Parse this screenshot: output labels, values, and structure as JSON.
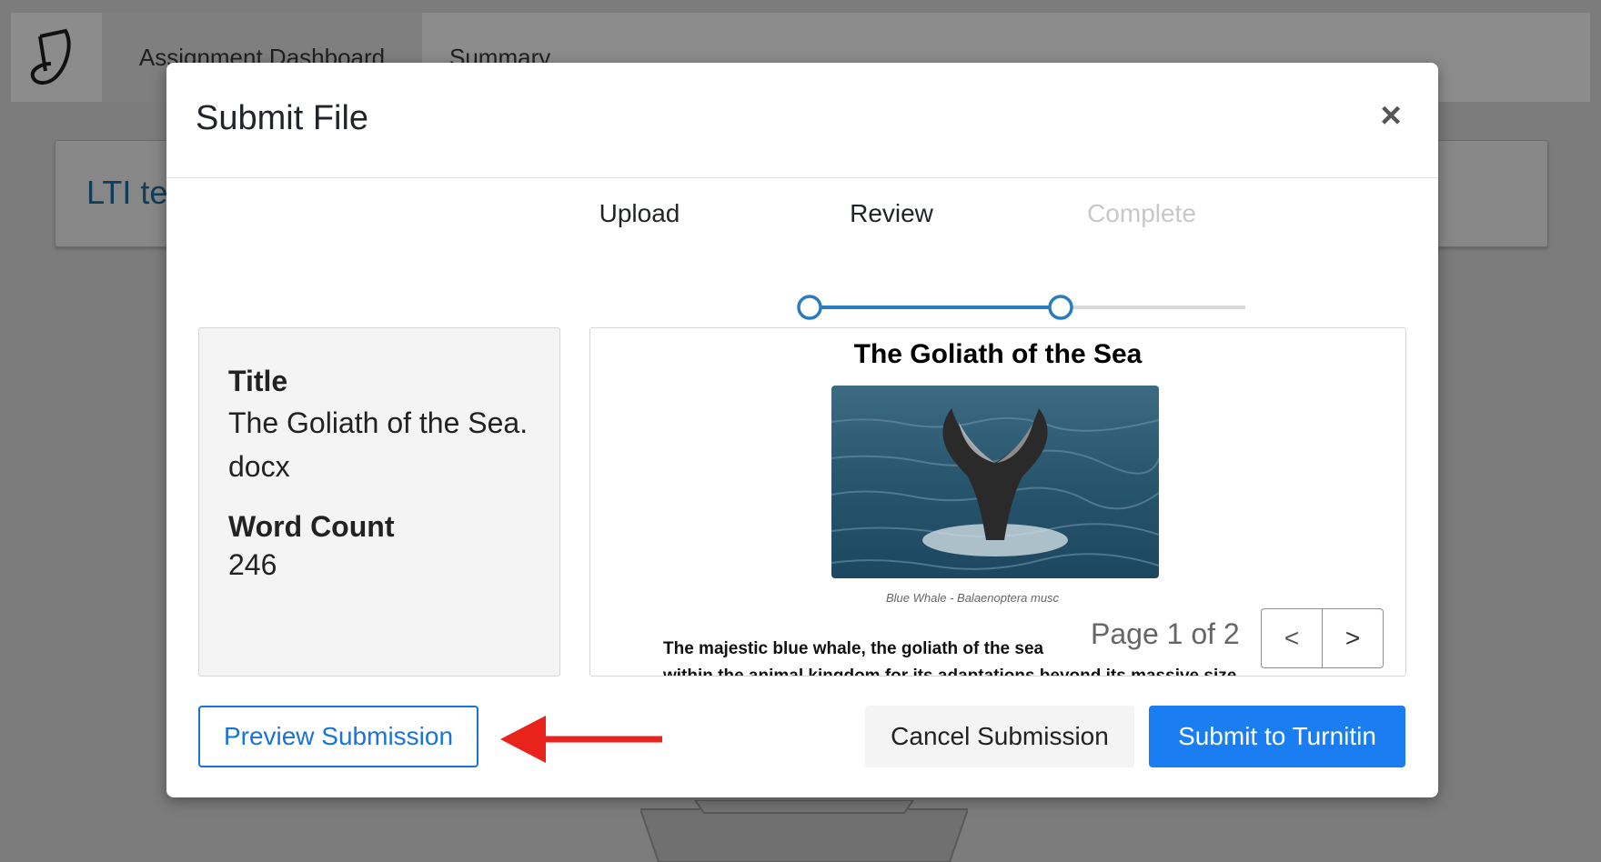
{
  "background": {
    "tabs": [
      {
        "label": "Assignment Dashboard"
      },
      {
        "label": "Summary"
      }
    ],
    "card_title": "LTI te"
  },
  "modal": {
    "title": "Submit File",
    "close_label": "×",
    "steps": [
      {
        "label": "Upload",
        "state": "done"
      },
      {
        "label": "Review",
        "state": "current"
      },
      {
        "label": "Complete",
        "state": "pending"
      }
    ],
    "details": {
      "title_label": "Title",
      "title_value": "The Goliath of the Sea.\ndocx",
      "word_count_label": "Word Count",
      "word_count_value": "246"
    },
    "preview": {
      "doc_title": "The Goliath of the Sea",
      "image_icon": "whale-tail-photo",
      "caption": "Blue Whale - Balaenoptera musc",
      "body_text": "The majestic blue whale, the goliath of the sea",
      "body_text_line2": "within the animal kingdom for its adaptations beyond its massive size",
      "page_text": "Page 1 of 2",
      "prev_label": "<",
      "next_label": ">"
    },
    "buttons": {
      "preview": "Preview Submission",
      "cancel": "Cancel Submission",
      "submit": "Submit to Turnitin"
    }
  },
  "colors": {
    "accent": "#1a7ef2",
    "step_done": "#2b7bbf",
    "step_pending": "#d0d0d0",
    "annotation_arrow": "#e8231b"
  }
}
